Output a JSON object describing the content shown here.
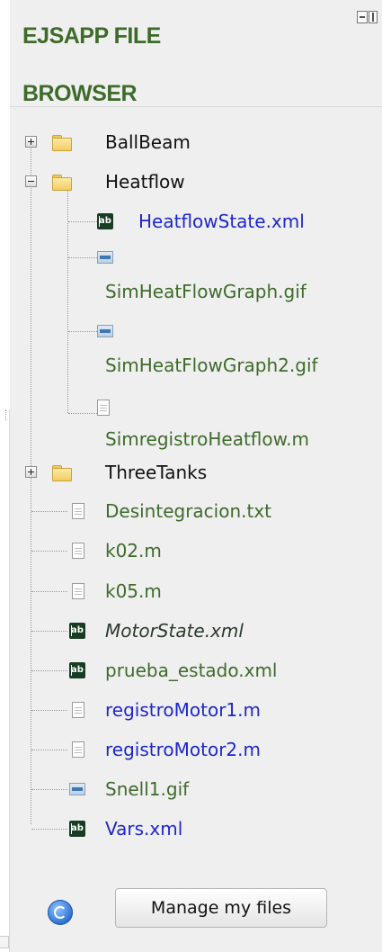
{
  "block": {
    "title": "EJSAPP FILE BROWSER",
    "hide_icon": "dock-hide-icon"
  },
  "tree": {
    "folders": [
      {
        "label": "BallBeam",
        "state": "collapsed"
      },
      {
        "label": "Heatflow",
        "state": "expanded",
        "children": [
          {
            "label": "HeatflowState.xml",
            "icon": "lab-file-icon"
          },
          {
            "label": "SimHeatFlowGraph.gif",
            "icon": "image-file-icon"
          },
          {
            "label": "SimHeatFlowGraph2.gif",
            "icon": "image-file-icon"
          },
          {
            "label": "SimregistroHeatflow.m",
            "icon": "text-file-icon"
          }
        ]
      },
      {
        "label": "ThreeTanks",
        "state": "collapsed"
      }
    ],
    "files": [
      {
        "label": "Desintegracion.txt",
        "icon": "text-file-icon"
      },
      {
        "label": "k02.m",
        "icon": "text-file-icon"
      },
      {
        "label": "k05.m",
        "icon": "text-file-icon"
      },
      {
        "label": "MotorState.xml",
        "icon": "lab-file-icon"
      },
      {
        "label": "prueba_estado.xml",
        "icon": "lab-file-icon"
      },
      {
        "label": "registroMotor1.m",
        "icon": "text-file-icon"
      },
      {
        "label": "registroMotor2.m",
        "icon": "text-file-icon"
      },
      {
        "label": "Snell1.gif",
        "icon": "image-file-icon"
      },
      {
        "label": "Vars.xml",
        "icon": "lab-file-icon"
      }
    ]
  },
  "footer": {
    "refresh_icon": "refresh-icon",
    "manage_label": "Manage my files"
  },
  "colors": {
    "title_green": "#3e6b2b",
    "link_blue": "#1d27cc",
    "block_bg": "#efefef"
  }
}
